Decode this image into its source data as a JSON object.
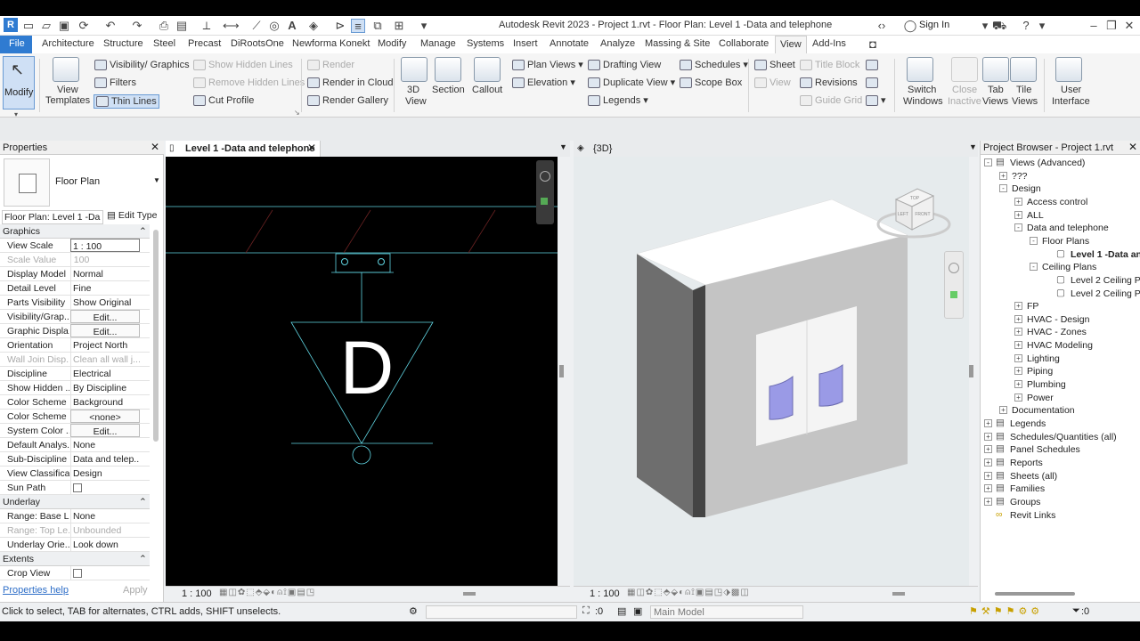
{
  "app": {
    "title": "Autodesk Revit 2023 - Project 1.rvt - Floor Plan: Level 1 -Data and telephone",
    "sign_in": "Sign In"
  },
  "menu_tabs": [
    "File",
    "Architecture",
    "Structure",
    "Steel",
    "Precast",
    "DiRootsOne",
    "Newforma Konekt",
    "Modify",
    "Manage",
    "Systems",
    "Insert",
    "Annotate",
    "Analyze",
    "Massing & Site",
    "Collaborate",
    "View",
    "Add-Ins"
  ],
  "ribbon": {
    "modify": "Modify",
    "view_templates": [
      "View",
      "Templates"
    ],
    "visibility_graphics": "Visibility/ Graphics",
    "filters": "Filters",
    "thin_lines": "Thin Lines",
    "show_hidden_lines": "Show Hidden Lines",
    "remove_hidden_lines": "Remove Hidden Lines",
    "cut_profile": "Cut Profile",
    "render": "Render",
    "render_in_cloud": "Render in Cloud",
    "render_gallery": "Render Gallery",
    "view3d": [
      "3D",
      "View"
    ],
    "section": "Section",
    "callout": "Callout",
    "plan_views": "Plan Views",
    "elevation": "Elevation",
    "drafting_view": "Drafting View",
    "duplicate_view": "Duplicate View",
    "legends": "Legends",
    "schedules": "Schedules",
    "scope_box": "Scope Box",
    "sheet": "Sheet",
    "view": "View",
    "title_block": "Title Block",
    "revisions": "Revisions",
    "guide_grid": "Guide Grid",
    "switch_windows": [
      "Switch",
      "Windows"
    ],
    "close_inactive": [
      "Close",
      "Inactive"
    ],
    "tab_views": [
      "Tab",
      "Views"
    ],
    "tile_views": [
      "Tile",
      "Views"
    ],
    "user_interface": [
      "User",
      "Interface"
    ]
  },
  "properties": {
    "title": "Properties",
    "type_name": "Floor Plan",
    "selector": "Floor Plan: Level 1 -Da",
    "edit_type": "Edit Type",
    "groups": {
      "graphics": "Graphics",
      "underlay": "Underlay",
      "extents": "Extents"
    },
    "graphics_rows": [
      {
        "k": "View Scale",
        "v": "1 : 100"
      },
      {
        "k": "Scale Value",
        "v": "100",
        "pre": "1:"
      },
      {
        "k": "Display Model",
        "v": "Normal"
      },
      {
        "k": "Detail Level",
        "v": "Fine"
      },
      {
        "k": "Parts Visibility",
        "v": "Show Original"
      },
      {
        "k": "Visibility/Grap...",
        "v": "Edit..."
      },
      {
        "k": "Graphic Displa...",
        "v": "Edit..."
      },
      {
        "k": "Orientation",
        "v": "Project North"
      },
      {
        "k": "Wall Join Disp...",
        "v": "Clean all wall j..."
      },
      {
        "k": "Discipline",
        "v": "Electrical"
      },
      {
        "k": "Show Hidden ...",
        "v": "By Discipline"
      },
      {
        "k": "Color Scheme ...",
        "v": "Background"
      },
      {
        "k": "Color Scheme",
        "v": "<none>"
      },
      {
        "k": "System Color ...",
        "v": "Edit..."
      },
      {
        "k": "Default Analys...",
        "v": "None"
      },
      {
        "k": "Sub-Discipline",
        "v": "Data and telep..."
      },
      {
        "k": "View Classifica...",
        "v": "Design"
      },
      {
        "k": "Sun Path",
        "v": ""
      }
    ],
    "underlay_rows": [
      {
        "k": "Range: Base L...",
        "v": "None"
      },
      {
        "k": "Range: Top Le...",
        "v": "Unbounded"
      },
      {
        "k": "Underlay Orie...",
        "v": "Look down"
      }
    ],
    "extents_rows": [
      {
        "k": "Crop View",
        "v": ""
      }
    ],
    "help": "Properties help",
    "apply": "Apply"
  },
  "view1": {
    "tab": "Level 1 -Data and telephone",
    "symbol_letter": "D",
    "scale": "1 : 100"
  },
  "view2": {
    "tab": "{3D}",
    "scale": "1 : 100",
    "cube_top": "TOP",
    "cube_left": "LEFT",
    "cube_front": "FRONT"
  },
  "browser": {
    "title": "Project Browser - Project 1.rvt",
    "nodes": [
      {
        "t": "Views (Advanced)",
        "lvl": 0,
        "exp": "-"
      },
      {
        "t": "???",
        "lvl": 1,
        "exp": "+"
      },
      {
        "t": "Design",
        "lvl": 1,
        "exp": "-"
      },
      {
        "t": "Access control",
        "lvl": 2,
        "exp": "+"
      },
      {
        "t": "ALL",
        "lvl": 2,
        "exp": "+"
      },
      {
        "t": "Data and telephone",
        "lvl": 2,
        "exp": "-"
      },
      {
        "t": "Floor Plans",
        "lvl": 3,
        "exp": "-"
      },
      {
        "t": "Level 1 -Data an",
        "lvl": 4,
        "exp": "",
        "bold": true
      },
      {
        "t": "Ceiling Plans",
        "lvl": 3,
        "exp": "-"
      },
      {
        "t": "Level 2 Ceiling P",
        "lvl": 4,
        "exp": ""
      },
      {
        "t": "Level 2 Ceiling P",
        "lvl": 4,
        "exp": ""
      },
      {
        "t": "FP",
        "lvl": 2,
        "exp": "+"
      },
      {
        "t": "HVAC - Design",
        "lvl": 2,
        "exp": "+"
      },
      {
        "t": "HVAC - Zones",
        "lvl": 2,
        "exp": "+"
      },
      {
        "t": "HVAC Modeling",
        "lvl": 2,
        "exp": "+"
      },
      {
        "t": "Lighting",
        "lvl": 2,
        "exp": "+"
      },
      {
        "t": "Piping",
        "lvl": 2,
        "exp": "+"
      },
      {
        "t": "Plumbing",
        "lvl": 2,
        "exp": "+"
      },
      {
        "t": "Power",
        "lvl": 2,
        "exp": "+"
      },
      {
        "t": "Documentation",
        "lvl": 1,
        "exp": "+"
      },
      {
        "t": "Legends",
        "lvl": 0,
        "exp": "+"
      },
      {
        "t": "Schedules/Quantities (all)",
        "lvl": 0,
        "exp": "+"
      },
      {
        "t": "Panel Schedules",
        "lvl": 0,
        "exp": "+"
      },
      {
        "t": "Reports",
        "lvl": 0,
        "exp": "+"
      },
      {
        "t": "Sheets (all)",
        "lvl": 0,
        "exp": "+"
      },
      {
        "t": "Families",
        "lvl": 0,
        "exp": "+"
      },
      {
        "t": "Groups",
        "lvl": 0,
        "exp": "+"
      },
      {
        "t": "Revit Links",
        "lvl": 0,
        "exp": ""
      }
    ]
  },
  "status": {
    "hint": "Click to select, TAB for alternates, CTRL adds, SHIFT unselects.",
    "zero": ":0",
    "model": "Main Model",
    "filter_count": ":0"
  },
  "colors": {
    "file_tab": "#2f7bd1",
    "cyan": "#5fd3e0"
  }
}
